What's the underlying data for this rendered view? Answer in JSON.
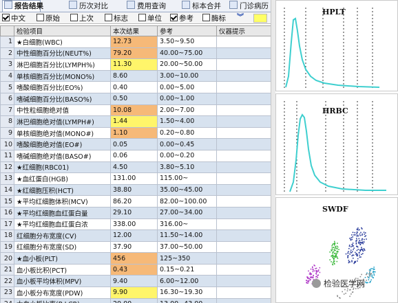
{
  "tabs": [
    {
      "label": "报告结果",
      "active": true
    },
    {
      "label": "历次对比",
      "active": false
    },
    {
      "label": "费用查询",
      "active": false
    },
    {
      "label": "标本合并",
      "active": false
    },
    {
      "label": "门诊病历",
      "active": false
    }
  ],
  "options": [
    {
      "label": "中文",
      "checked": true
    },
    {
      "label": "原始",
      "checked": false
    },
    {
      "label": "上次",
      "checked": false
    },
    {
      "label": "标志",
      "checked": false
    },
    {
      "label": "单位",
      "checked": false
    },
    {
      "label": "参考",
      "checked": true
    },
    {
      "label": "酶标",
      "checked": false
    }
  ],
  "expand_icon": "double-chevron-down-icon",
  "columns": [
    "检验项目",
    "本次结果",
    "参考",
    "仪器提示"
  ],
  "rows": [
    {
      "no": "1",
      "item": "★白细胞(WBC)",
      "result": "12.73",
      "ref": "3.50~9.50",
      "hl": "orange"
    },
    {
      "no": "2",
      "item": "中性细胞百分比(NEUT%)",
      "result": "79.20",
      "ref": "40.00~75.00",
      "hl": "orange"
    },
    {
      "no": "3",
      "item": "淋巴细胞百分比(LYMPH%)",
      "result": "11.30",
      "ref": "20.00~50.00",
      "hl": "yellow"
    },
    {
      "no": "4",
      "item": "单核细胞百分比(MONO%)",
      "result": "8.60",
      "ref": "3.00~10.00",
      "hl": ""
    },
    {
      "no": "5",
      "item": "嗜酸细胞百分比(EO%)",
      "result": "0.40",
      "ref": "0.00~5.00",
      "hl": ""
    },
    {
      "no": "6",
      "item": "嗜碱细胞百分比(BASO%)",
      "result": "0.50",
      "ref": "0.00~1.00",
      "hl": ""
    },
    {
      "no": "7",
      "item": "中性粒细胞绝对值",
      "result": "10.08",
      "ref": "2.00~7.00",
      "hl": "orange"
    },
    {
      "no": "8",
      "item": "淋巴细胞绝对值(LYMPH#)",
      "result": "1.44",
      "ref": "1.50~4.00",
      "hl": "yellow"
    },
    {
      "no": "9",
      "item": "单核细胞绝对值(MONO#)",
      "result": "1.10",
      "ref": "0.20~0.80",
      "hl": "orange"
    },
    {
      "no": "10",
      "item": "嗜酸细胞绝对值(EO#)",
      "result": "0.05",
      "ref": "0.00~0.45",
      "hl": ""
    },
    {
      "no": "11",
      "item": "嗜碱细胞绝对值(BASO#)",
      "result": "0.06",
      "ref": "0.00~0.20",
      "hl": ""
    },
    {
      "no": "12",
      "item": "★红细胞(RBC01)",
      "result": "4.50",
      "ref": "3.80~5.10",
      "hl": ""
    },
    {
      "no": "13",
      "item": "★血红蛋白(HGB)",
      "result": "131.00",
      "ref": "115.00~",
      "hl": ""
    },
    {
      "no": "14",
      "item": "★红细胞压积(HCT)",
      "result": "38.80",
      "ref": "35.00~45.00",
      "hl": ""
    },
    {
      "no": "15",
      "item": "★平均红细胞体积(MCV)",
      "result": "86.20",
      "ref": "82.00~100.00",
      "hl": ""
    },
    {
      "no": "16",
      "item": "★平均红细胞血红蛋白量",
      "result": "29.10",
      "ref": "27.00~34.00",
      "hl": ""
    },
    {
      "no": "17",
      "item": "★平均红细胞血红蛋白浓",
      "result": "338.00",
      "ref": "316.00~",
      "hl": ""
    },
    {
      "no": "18",
      "item": "红细胞分布宽度(CV)",
      "result": "12.00",
      "ref": "11.50~14.00",
      "hl": ""
    },
    {
      "no": "19",
      "item": "红细胞分布宽度(SD)",
      "result": "37.90",
      "ref": "37.00~50.00",
      "hl": ""
    },
    {
      "no": "20",
      "item": "★血小板(PLT)",
      "result": "456",
      "ref": "125~350",
      "hl": "orange"
    },
    {
      "no": "21",
      "item": "血小板比积(PCT)",
      "result": "0.43",
      "ref": "0.15~0.21",
      "hl": "orange"
    },
    {
      "no": "22",
      "item": "血小板平均体积(MPV)",
      "result": "9.40",
      "ref": "6.00~12.00",
      "hl": ""
    },
    {
      "no": "23",
      "item": "血小板分布宽度(PDW)",
      "result": "9.90",
      "ref": "16.30~19.30",
      "hl": "yellow"
    },
    {
      "no": "24",
      "item": "大血小板比率(P-LCR)",
      "result": "20.00",
      "ref": "13.00~43.00",
      "hl": ""
    }
  ],
  "graphs": {
    "plt_label": "HPLT",
    "rbc_label": "HRBC",
    "scatter_label": "SWDF"
  },
  "colors": {
    "orange": "#f6b978",
    "yellow": "#fff56a",
    "curve": "#3ecfcf"
  },
  "watermark": {
    "icon": "wechat-icon",
    "text": "检验医学网"
  }
}
